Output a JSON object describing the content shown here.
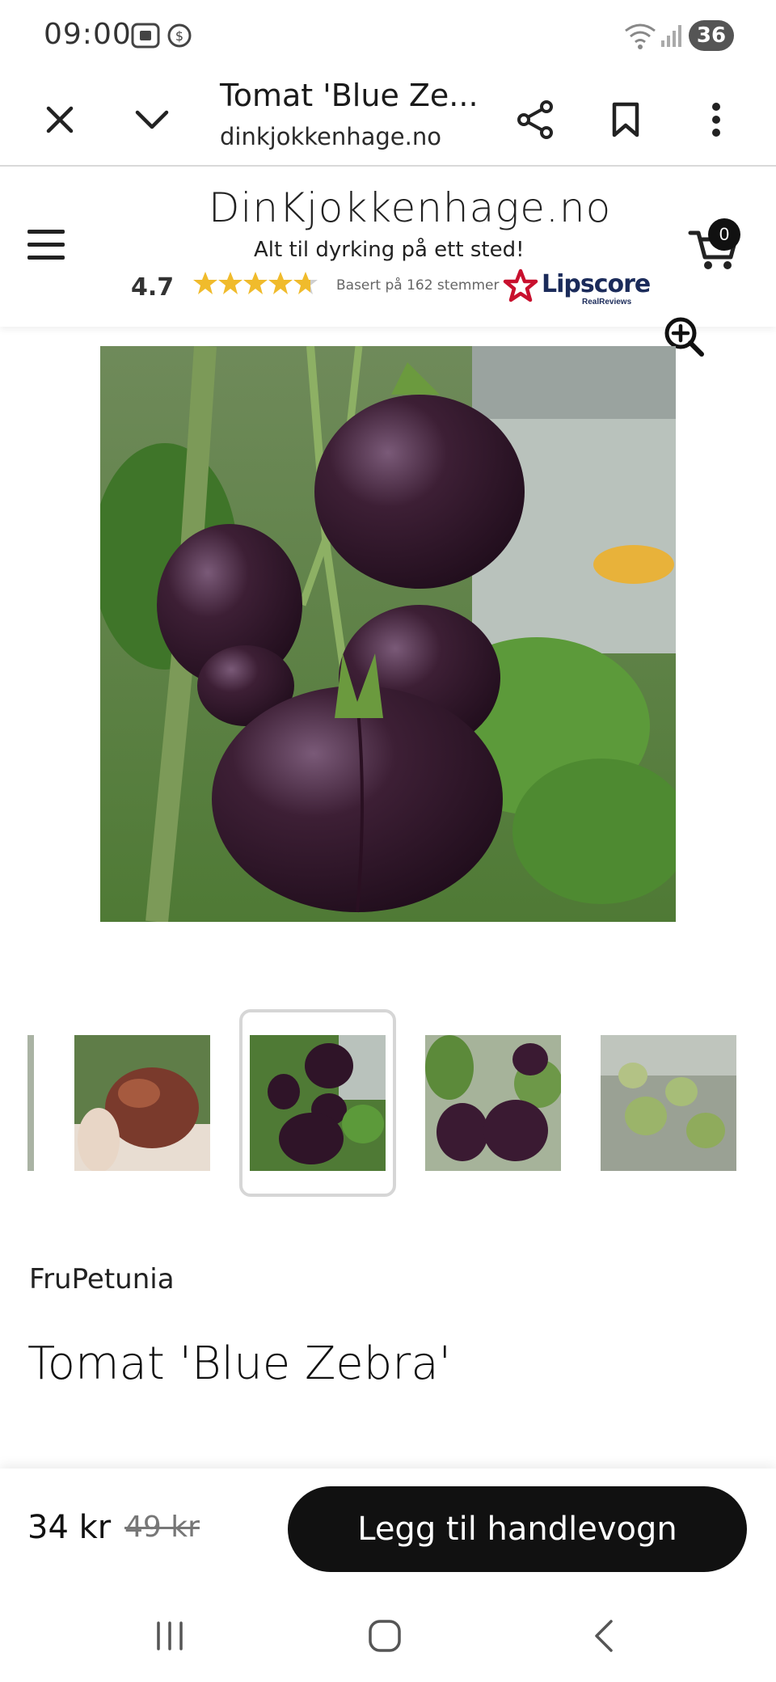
{
  "status_bar": {
    "time": "09:00",
    "battery_level": "36"
  },
  "browser": {
    "page_title": "Tomat 'Blue Ze...",
    "url": "dinkjokkenhage.no"
  },
  "site": {
    "logo_text": "DinKjokkenhage.no",
    "tagline": "Alt til dyrking på ett sted!",
    "rating_score": "4.7",
    "rating_stars": 4.7,
    "rating_text": "Basert på 162 stemmer",
    "lipscore_brand": "Lipscore",
    "lipscore_sub": "RealReviews",
    "cart_count": "0"
  },
  "gallery": {
    "thumbnails": [
      {
        "name": "thumb-partial"
      },
      {
        "name": "thumb-tomato-in-hand"
      },
      {
        "name": "thumb-tomatoes-vine",
        "selected": true
      },
      {
        "name": "thumb-tomatoes-leaves"
      },
      {
        "name": "thumb-green-tomatoes"
      }
    ]
  },
  "product": {
    "vendor": "FruPetunia",
    "title": "Tomat 'Blue Zebra'",
    "price": "34 kr",
    "old_price": "49 kr",
    "add_to_cart_label": "Legg til handlevogn"
  },
  "colors": {
    "accent": "#111111",
    "star": "#f0bb2c",
    "lipscore_red": "#c8102e"
  }
}
